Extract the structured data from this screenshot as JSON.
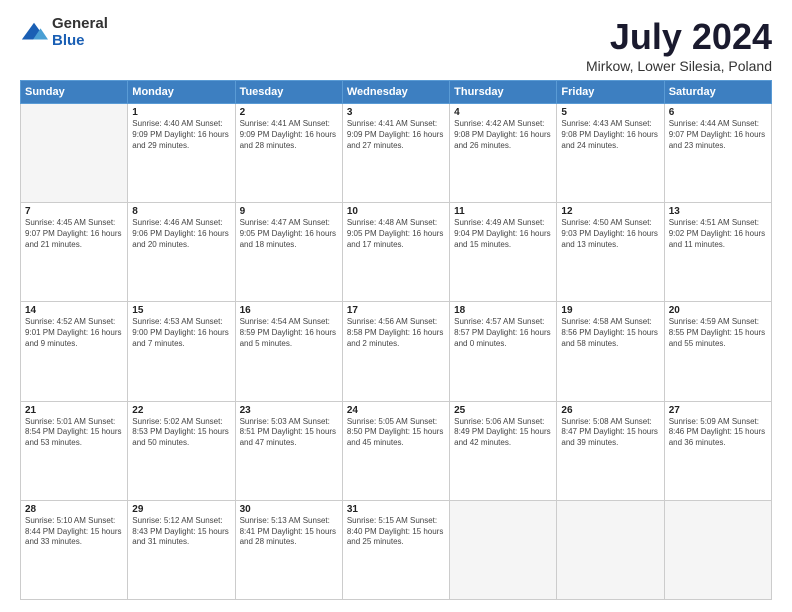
{
  "header": {
    "logo_general": "General",
    "logo_blue": "Blue",
    "title": "July 2024",
    "subtitle": "Mirkow, Lower Silesia, Poland"
  },
  "calendar": {
    "days_of_week": [
      "Sunday",
      "Monday",
      "Tuesday",
      "Wednesday",
      "Thursday",
      "Friday",
      "Saturday"
    ],
    "weeks": [
      [
        {
          "day": "",
          "info": ""
        },
        {
          "day": "1",
          "info": "Sunrise: 4:40 AM\nSunset: 9:09 PM\nDaylight: 16 hours\nand 29 minutes."
        },
        {
          "day": "2",
          "info": "Sunrise: 4:41 AM\nSunset: 9:09 PM\nDaylight: 16 hours\nand 28 minutes."
        },
        {
          "day": "3",
          "info": "Sunrise: 4:41 AM\nSunset: 9:09 PM\nDaylight: 16 hours\nand 27 minutes."
        },
        {
          "day": "4",
          "info": "Sunrise: 4:42 AM\nSunset: 9:08 PM\nDaylight: 16 hours\nand 26 minutes."
        },
        {
          "day": "5",
          "info": "Sunrise: 4:43 AM\nSunset: 9:08 PM\nDaylight: 16 hours\nand 24 minutes."
        },
        {
          "day": "6",
          "info": "Sunrise: 4:44 AM\nSunset: 9:07 PM\nDaylight: 16 hours\nand 23 minutes."
        }
      ],
      [
        {
          "day": "7",
          "info": "Sunrise: 4:45 AM\nSunset: 9:07 PM\nDaylight: 16 hours\nand 21 minutes."
        },
        {
          "day": "8",
          "info": "Sunrise: 4:46 AM\nSunset: 9:06 PM\nDaylight: 16 hours\nand 20 minutes."
        },
        {
          "day": "9",
          "info": "Sunrise: 4:47 AM\nSunset: 9:05 PM\nDaylight: 16 hours\nand 18 minutes."
        },
        {
          "day": "10",
          "info": "Sunrise: 4:48 AM\nSunset: 9:05 PM\nDaylight: 16 hours\nand 17 minutes."
        },
        {
          "day": "11",
          "info": "Sunrise: 4:49 AM\nSunset: 9:04 PM\nDaylight: 16 hours\nand 15 minutes."
        },
        {
          "day": "12",
          "info": "Sunrise: 4:50 AM\nSunset: 9:03 PM\nDaylight: 16 hours\nand 13 minutes."
        },
        {
          "day": "13",
          "info": "Sunrise: 4:51 AM\nSunset: 9:02 PM\nDaylight: 16 hours\nand 11 minutes."
        }
      ],
      [
        {
          "day": "14",
          "info": "Sunrise: 4:52 AM\nSunset: 9:01 PM\nDaylight: 16 hours\nand 9 minutes."
        },
        {
          "day": "15",
          "info": "Sunrise: 4:53 AM\nSunset: 9:00 PM\nDaylight: 16 hours\nand 7 minutes."
        },
        {
          "day": "16",
          "info": "Sunrise: 4:54 AM\nSunset: 8:59 PM\nDaylight: 16 hours\nand 5 minutes."
        },
        {
          "day": "17",
          "info": "Sunrise: 4:56 AM\nSunset: 8:58 PM\nDaylight: 16 hours\nand 2 minutes."
        },
        {
          "day": "18",
          "info": "Sunrise: 4:57 AM\nSunset: 8:57 PM\nDaylight: 16 hours\nand 0 minutes."
        },
        {
          "day": "19",
          "info": "Sunrise: 4:58 AM\nSunset: 8:56 PM\nDaylight: 15 hours\nand 58 minutes."
        },
        {
          "day": "20",
          "info": "Sunrise: 4:59 AM\nSunset: 8:55 PM\nDaylight: 15 hours\nand 55 minutes."
        }
      ],
      [
        {
          "day": "21",
          "info": "Sunrise: 5:01 AM\nSunset: 8:54 PM\nDaylight: 15 hours\nand 53 minutes."
        },
        {
          "day": "22",
          "info": "Sunrise: 5:02 AM\nSunset: 8:53 PM\nDaylight: 15 hours\nand 50 minutes."
        },
        {
          "day": "23",
          "info": "Sunrise: 5:03 AM\nSunset: 8:51 PM\nDaylight: 15 hours\nand 47 minutes."
        },
        {
          "day": "24",
          "info": "Sunrise: 5:05 AM\nSunset: 8:50 PM\nDaylight: 15 hours\nand 45 minutes."
        },
        {
          "day": "25",
          "info": "Sunrise: 5:06 AM\nSunset: 8:49 PM\nDaylight: 15 hours\nand 42 minutes."
        },
        {
          "day": "26",
          "info": "Sunrise: 5:08 AM\nSunset: 8:47 PM\nDaylight: 15 hours\nand 39 minutes."
        },
        {
          "day": "27",
          "info": "Sunrise: 5:09 AM\nSunset: 8:46 PM\nDaylight: 15 hours\nand 36 minutes."
        }
      ],
      [
        {
          "day": "28",
          "info": "Sunrise: 5:10 AM\nSunset: 8:44 PM\nDaylight: 15 hours\nand 33 minutes."
        },
        {
          "day": "29",
          "info": "Sunrise: 5:12 AM\nSunset: 8:43 PM\nDaylight: 15 hours\nand 31 minutes."
        },
        {
          "day": "30",
          "info": "Sunrise: 5:13 AM\nSunset: 8:41 PM\nDaylight: 15 hours\nand 28 minutes."
        },
        {
          "day": "31",
          "info": "Sunrise: 5:15 AM\nSunset: 8:40 PM\nDaylight: 15 hours\nand 25 minutes."
        },
        {
          "day": "",
          "info": ""
        },
        {
          "day": "",
          "info": ""
        },
        {
          "day": "",
          "info": ""
        }
      ]
    ]
  }
}
